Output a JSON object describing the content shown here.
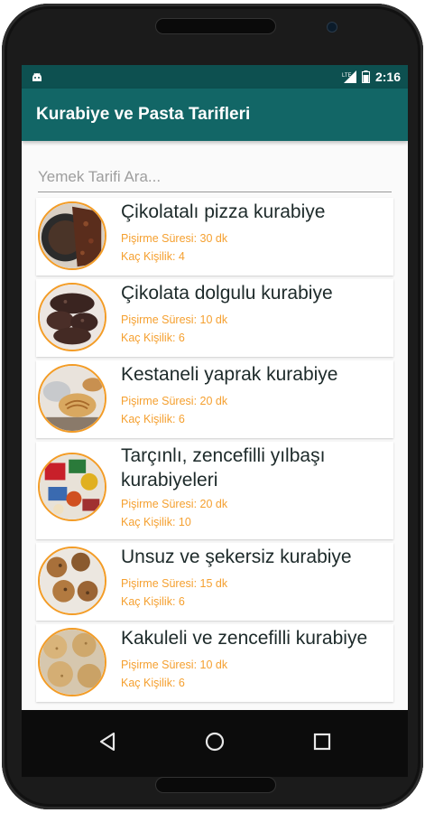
{
  "status": {
    "time": "2:16"
  },
  "app": {
    "title": "Kurabiye ve Pasta Tarifleri"
  },
  "search": {
    "placeholder": "Yemek Tarifi Ara..."
  },
  "labels": {
    "time_label": "Pişirme Süresi:",
    "serves_label": "Kaç Kişilik:"
  },
  "recipes": [
    {
      "title": "Çikolatalı pizza kurabiye",
      "cook_time": "Pişirme Süresi: 30 dk",
      "serves": "Kaç Kişilik: 4"
    },
    {
      "title": "Çikolata dolgulu kurabiye",
      "cook_time": "Pişirme Süresi: 10 dk",
      "serves": "Kaç Kişilik: 6"
    },
    {
      "title": "Kestaneli yaprak kurabiye",
      "cook_time": "Pişirme Süresi: 20 dk",
      "serves": "Kaç Kişilik: 6"
    },
    {
      "title": "Tarçınlı, zencefilli yılbaşı kurabiyeleri",
      "cook_time": "Pişirme Süresi: 20 dk",
      "serves": "Kaç Kişilik: 10"
    },
    {
      "title": "Unsuz ve şekersiz kurabiye",
      "cook_time": "Pişirme Süresi: 15 dk",
      "serves": "Kaç Kişilik: 6"
    },
    {
      "title": "Kakuleli ve zencefilli kurabiye",
      "cook_time": "Pişirme Süresi: 10 dk",
      "serves": "Kaç Kişilik: 6"
    }
  ],
  "colors": {
    "toolbar": "#126666",
    "statusbar": "#0d5050",
    "accent": "#f39c26"
  },
  "icons": {
    "back": "back-triangle-icon",
    "home": "home-circle-icon",
    "recents": "recents-square-icon"
  }
}
